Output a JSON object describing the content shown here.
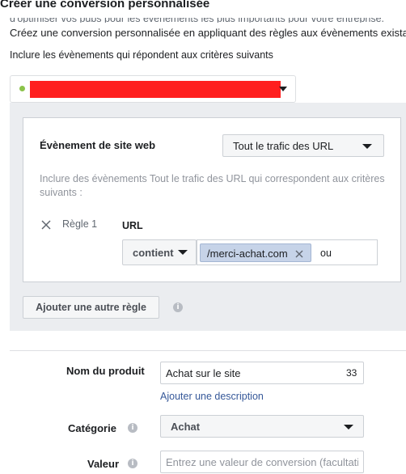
{
  "header": {
    "title": "Créer une conversion personnalisée",
    "cut_line": "d'optimiser vos pubs pour les évènements les plus importants pour votre entreprise.",
    "subtitle": "Créez une conversion personnalisée en appliquant des règles aux évènements existants"
  },
  "criteria": {
    "label": "Inclure les évènements qui répondent aux critères suivants"
  },
  "rule_card": {
    "event_label": "Évènement de site web",
    "event_select": "Tout le trafic des URL",
    "hint": "Inclure des évènements Tout le trafic des URL qui correspondent aux critères suivants :",
    "rule_label": "Règle 1",
    "url_label": "URL",
    "operator_select": "contient",
    "url_token": "/merci-achat.com",
    "or_text": "ou"
  },
  "add_rule_button": "Ajouter une autre règle",
  "form": {
    "product_name_label": "Nom du produit",
    "product_name_value": "Achat sur le site",
    "product_name_counter": "33",
    "add_description": "Ajouter une description",
    "category_label": "Catégorie",
    "category_value": "Achat",
    "value_label": "Valeur",
    "value_placeholder": "Entrez une valeur de conversion (facultatif)"
  },
  "icons": {
    "info": "i",
    "status_dot_color": "#8bc34a",
    "redaction_color": "#ff1f1f"
  }
}
